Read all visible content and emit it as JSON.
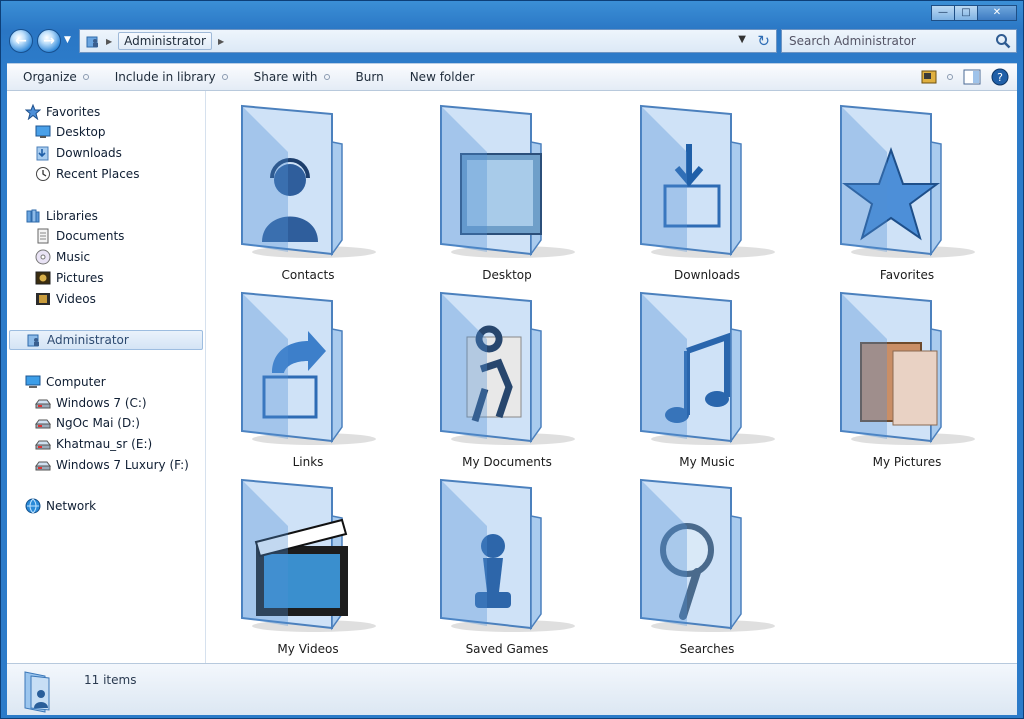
{
  "window": {
    "minimize_glyph": "—",
    "maximize_glyph": "□",
    "close_glyph": "✕"
  },
  "address_bar": {
    "location": "Administrator",
    "refresh_icon": "refresh-icon"
  },
  "search": {
    "placeholder": "Search Administrator"
  },
  "toolbar": {
    "organize": "Organize",
    "include_in_library": "Include in library",
    "share_with": "Share with",
    "burn": "Burn",
    "new_folder": "New folder"
  },
  "nav_pane": {
    "favorites": {
      "label": "Favorites",
      "items": [
        "Desktop",
        "Downloads",
        "Recent Places"
      ]
    },
    "libraries": {
      "label": "Libraries",
      "items": [
        "Documents",
        "Music",
        "Pictures",
        "Videos"
      ]
    },
    "user": "Administrator",
    "computer": {
      "label": "Computer",
      "items": [
        "Windows 7 (C:)",
        "NgOc Mai (D:)",
        "Khatmau_sr (E:)",
        "Windows 7 Luxury (F:)"
      ]
    },
    "network": "Network"
  },
  "items": [
    {
      "label": "Contacts",
      "icon": "contacts-icon"
    },
    {
      "label": "Desktop",
      "icon": "desktop-icon"
    },
    {
      "label": "Downloads",
      "icon": "downloads-icon"
    },
    {
      "label": "Favorites",
      "icon": "star-icon"
    },
    {
      "label": "Links",
      "icon": "links-icon"
    },
    {
      "label": "My Documents",
      "icon": "documents-icon"
    },
    {
      "label": "My Music",
      "icon": "music-note-icon"
    },
    {
      "label": "My Pictures",
      "icon": "pictures-icon"
    },
    {
      "label": "My Videos",
      "icon": "clapperboard-icon"
    },
    {
      "label": "Saved Games",
      "icon": "chess-pawn-icon"
    },
    {
      "label": "Searches",
      "icon": "magnifier-icon"
    }
  ],
  "status_bar": {
    "count": "11 items"
  },
  "colors": {
    "frame": "#2a76c4",
    "folder_light": "#cfe2f7",
    "folder_dark": "#4f8fd3",
    "selection": "#d4e4f5"
  }
}
